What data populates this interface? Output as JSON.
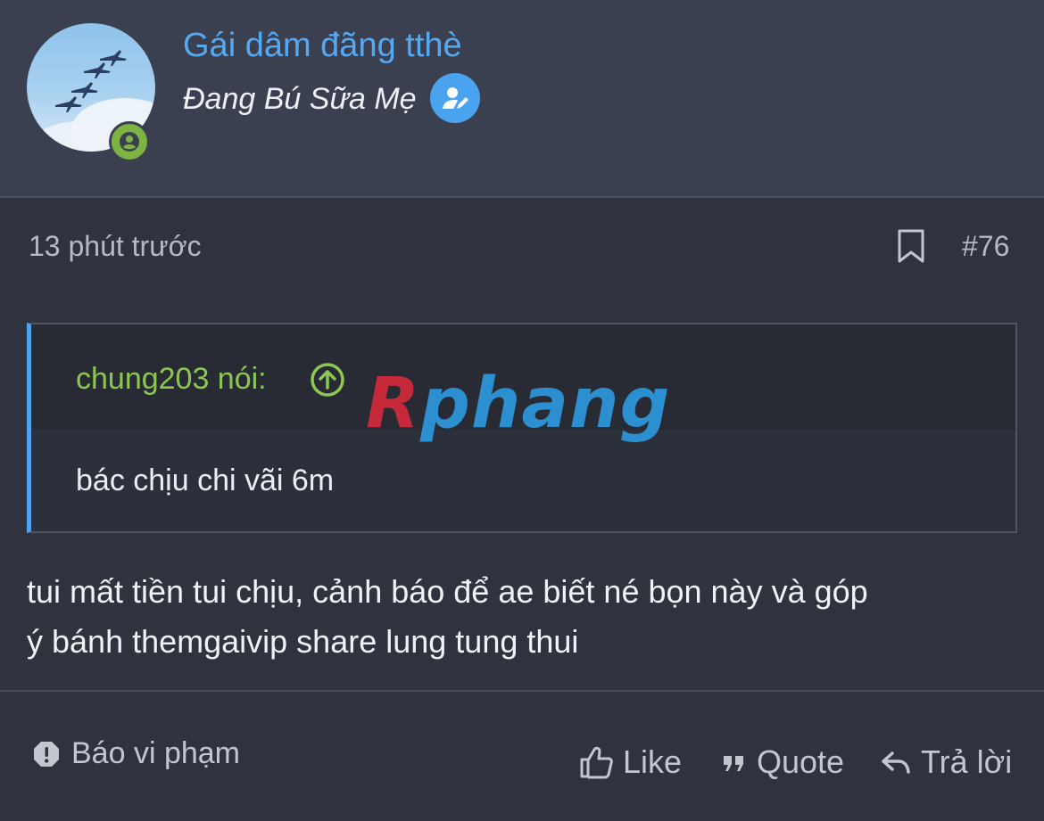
{
  "header": {
    "username": "Gái dâm đãng tthè",
    "user_title": "Đang Bú Sữa Mẹ",
    "avatar_icon": "fighter-jets-formation",
    "online_icon": "user-online-icon",
    "title_badge_icon": "user-edit-icon"
  },
  "post": {
    "time": "13 phút trước",
    "number": "#76",
    "bookmark_icon": "bookmark-icon",
    "quote": {
      "author": "chung203 nói:",
      "jump_icon": "arrow-up-circle-icon",
      "text": "bác chịu chi vãi 6m"
    },
    "body_line1": "tui mất tiền tui chịu, cảnh báo để ae biết né bọn này và góp",
    "body_line2": "ý bánh themgaivip share lung tung thui"
  },
  "watermark": {
    "first_letter": "R",
    "rest": "phang"
  },
  "footer": {
    "report_label": "Báo vi phạm",
    "like_label": "Like",
    "quote_label": "Quote",
    "reply_label": "Trả lời"
  },
  "colors": {
    "header_bg": "#3b4050",
    "page_bg": "#2f333e",
    "username": "#54a9f2",
    "quote_author": "#8dc653",
    "accent": "#4ea2ef",
    "online": "#7cb342"
  }
}
